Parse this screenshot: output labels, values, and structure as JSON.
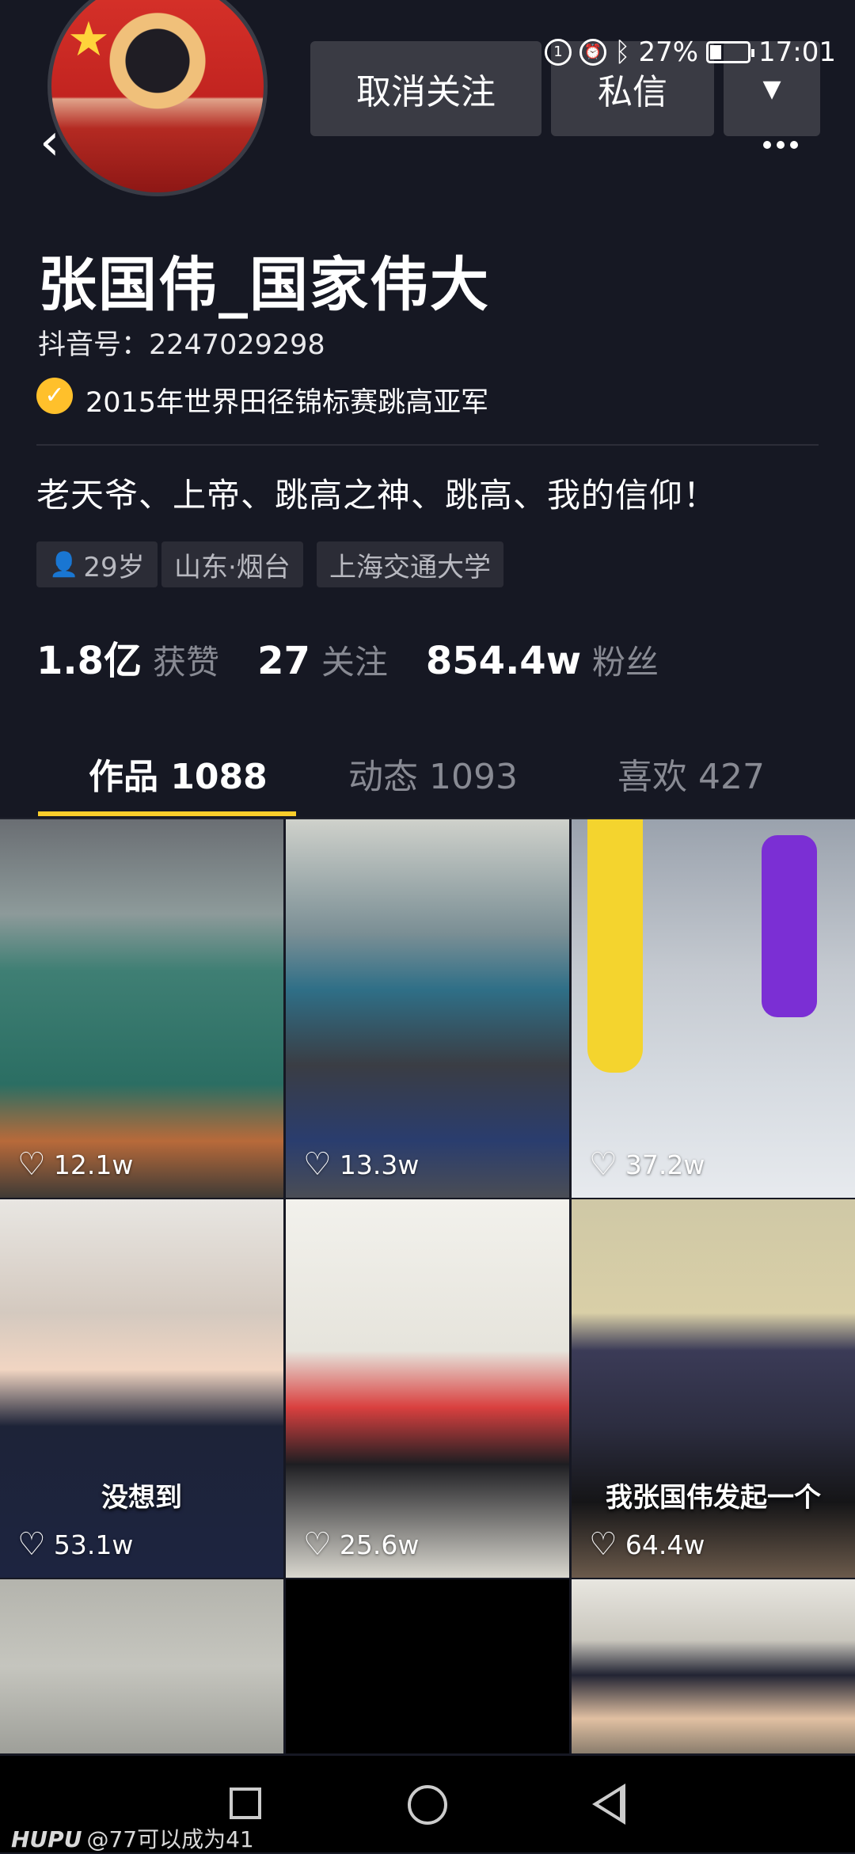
{
  "status_bar": {
    "signal_icon": "signal-icon",
    "battery_percent": "27%",
    "time": "17:01"
  },
  "header": {
    "unfollow_label": "取消关注",
    "message_label": "私信",
    "dropdown_glyph": "▼",
    "back_glyph": "‹"
  },
  "profile": {
    "name": "张国伟_国家伟大",
    "douyin_id": "抖音号：2247029298",
    "verification": "2015年世界田径锦标赛跳高亚军",
    "bio": "老天爷、上帝、跳高之神、跳高、我的信仰！",
    "tags": {
      "age": "29岁",
      "location": "山东·烟台",
      "school": "上海交通大学"
    },
    "stats": {
      "likes_value": "1.8亿",
      "likes_label": "获赞",
      "following_value": "27",
      "following_label": "关注",
      "followers_value": "854.4w",
      "followers_label": "粉丝"
    }
  },
  "tabs": {
    "works": "作品 1088",
    "dynamic": "动态 1093",
    "likes": "喜欢 427"
  },
  "videos": [
    {
      "likes": "12.1w",
      "caption": ""
    },
    {
      "likes": "13.3w",
      "caption": ""
    },
    {
      "likes": "37.2w",
      "caption": ""
    },
    {
      "likes": "53.1w",
      "caption": "没想到"
    },
    {
      "likes": "25.6w",
      "caption": ""
    },
    {
      "likes": "64.4w",
      "caption": "我张国伟发起一个"
    }
  ],
  "watermark": {
    "brand": "HUPU",
    "handle": "@77可以成为41"
  },
  "colors": {
    "background": "#161823",
    "accent_tab": "#facd2b",
    "verified": "#ffc02b"
  }
}
